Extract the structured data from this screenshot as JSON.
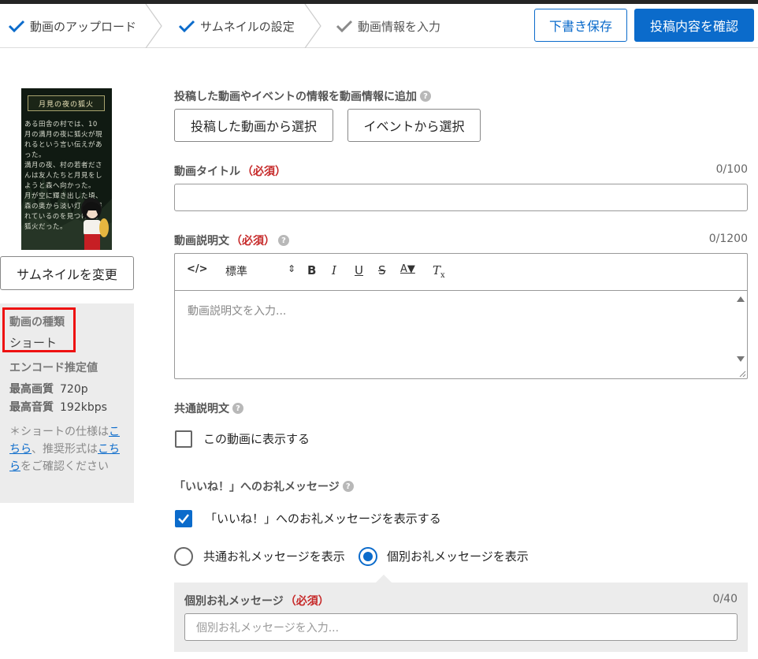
{
  "steps": [
    {
      "label": "動画のアップロード",
      "state": "done"
    },
    {
      "label": "サムネイルの設定",
      "state": "done"
    },
    {
      "label": "動画情報を入力",
      "state": "current"
    }
  ],
  "header": {
    "draft_label": "下書き保存",
    "confirm_label": "投稿内容を確認"
  },
  "thumbnail": {
    "title": "月見の夜の狐火",
    "lines": [
      "ある田舎の村では、10",
      "月の満月の夜に狐火が現",
      "れるという言い伝えがあ",
      "った。",
      "満月の夜、村の若者ださ",
      "んは友人たちと月見をし",
      "ようと森へ向かった。",
      "月が空に輝き出した頃、",
      "森の奥から淡い灯火が揺",
      "れているのを見つけた。",
      "狐火だった。"
    ],
    "change_label": "サムネイルを変更"
  },
  "video_info": {
    "type_label": "動画の種類",
    "type_value": "ショート",
    "encode_label": "エンコード推定値",
    "quality_label": "最高画質",
    "quality_value": "720p",
    "audio_label": "最高音質",
    "audio_value": "192kbps",
    "note_prefix": "＊ショートの仕様は",
    "note_link1": "こちら",
    "note_mid": "、推奨形式は",
    "note_link2": "こちら",
    "note_suffix": "をご確認ください"
  },
  "related": {
    "label": "投稿した動画やイベントの情報を動画情報に追加",
    "from_video_label": "投稿した動画から選択",
    "from_event_label": "イベントから選択"
  },
  "title_field": {
    "label": "動画タイトル",
    "required": "（必須）",
    "counter": "0/100",
    "value": ""
  },
  "description": {
    "label": "動画説明文",
    "required": "（必須）",
    "counter": "0/1200",
    "placeholder": "動画説明文を入力...",
    "format_select": "標準"
  },
  "common_desc": {
    "label": "共通説明文",
    "checkbox_label": "この動画に表示する",
    "checked": false
  },
  "like_msg": {
    "label": "「いいね！」へのお礼メッセージ",
    "show_label": "「いいね！」へのお礼メッセージを表示する",
    "show_checked": true,
    "radio_common": "共通お礼メッセージを表示",
    "radio_individual": "個別お礼メッセージを表示",
    "selected": "individual",
    "individual_label": "個別お礼メッセージ",
    "individual_required": "（必須）",
    "individual_counter": "0/40",
    "individual_placeholder": "個別お礼メッセージを入力..."
  },
  "colors": {
    "accent": "#0b6bcb",
    "required": "#c62828",
    "highlight": "#ee1111"
  }
}
